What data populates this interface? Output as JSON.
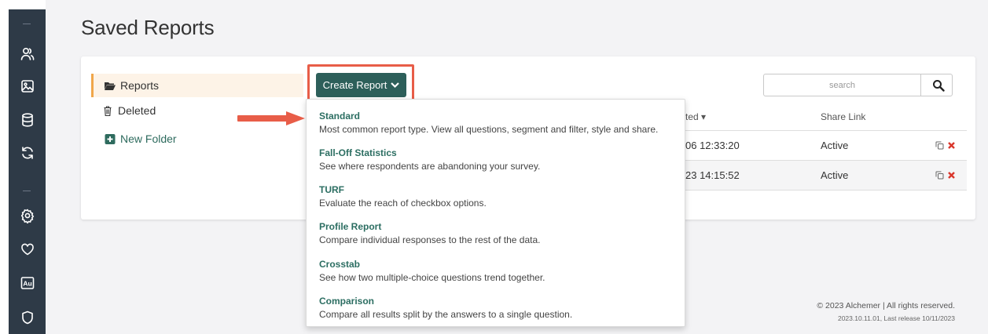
{
  "page": {
    "title": "Saved Reports"
  },
  "sidebar_rail": {
    "icons": [
      "users-icon",
      "image-icon",
      "database-icon",
      "refresh-icon",
      "settings-icon",
      "heart-icon",
      "au-icon",
      "shield-icon"
    ],
    "au_label": "Au"
  },
  "folders": {
    "reports": "Reports",
    "deleted": "Deleted",
    "new_folder": "New Folder"
  },
  "toolbar": {
    "create_report_label": "Create Report",
    "search_placeholder": "search"
  },
  "table": {
    "headers": {
      "date_partial": "ted",
      "share_link": "Share Link"
    },
    "rows": [
      {
        "date": "06 12:33:20",
        "share": "Active"
      },
      {
        "date": "23 14:15:52",
        "share": "Active"
      }
    ]
  },
  "create_menu": {
    "items": [
      {
        "title": "Standard",
        "description": "Most common report type. View all questions, segment and filter, style and share."
      },
      {
        "title": "Fall-Off Statistics",
        "description": "See where respondents are abandoning your survey."
      },
      {
        "title": "TURF",
        "description": "Evaluate the reach of checkbox options."
      },
      {
        "title": "Profile Report",
        "description": "Compare individual responses to the rest of the data."
      },
      {
        "title": "Crosstab",
        "description": "See how two multiple-choice questions trend together."
      },
      {
        "title": "Comparison",
        "description": "Compare all results split by the answers to a single question."
      }
    ]
  },
  "footer": {
    "copyright": "© 2023 Alchemer | All rights reserved.",
    "version": "2023.10.11.01, Last release 10/11/2023"
  },
  "colors": {
    "rail": "#2e3a47",
    "accent_green": "#2d5f5a",
    "highlight_red": "#e85d48",
    "folder_active_border": "#f0a64a",
    "delete_red": "#d9362b"
  }
}
